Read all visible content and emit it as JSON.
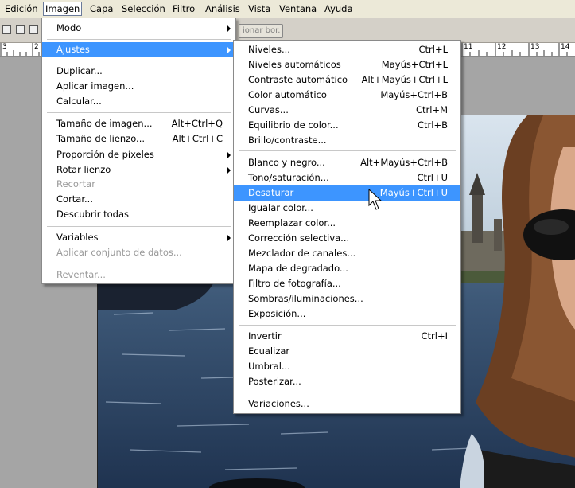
{
  "menubar": {
    "items": [
      {
        "label": "Edición"
      },
      {
        "label": "Imagen"
      },
      {
        "label": "Capa"
      },
      {
        "label": "Selección"
      },
      {
        "label": "Filtro"
      },
      {
        "label": "Análisis"
      },
      {
        "label": "Vista"
      },
      {
        "label": "Ventana"
      },
      {
        "label": "Ayuda"
      }
    ]
  },
  "options": {
    "button_label": "ionar bor."
  },
  "ruler": {
    "left_labels": [
      "3",
      "2"
    ],
    "right_labels": [
      "11",
      "12",
      "13",
      "14"
    ]
  },
  "imagen_menu": {
    "items": [
      {
        "label": "Modo",
        "shortcut": "",
        "submenu": true
      },
      {
        "label": "Ajustes",
        "shortcut": "",
        "submenu": true,
        "selected": true
      },
      {
        "label": "Duplicar...",
        "shortcut": ""
      },
      {
        "label": "Aplicar imagen...",
        "shortcut": ""
      },
      {
        "label": "Calcular...",
        "shortcut": ""
      },
      {
        "label": "Tamaño de imagen...",
        "shortcut": "Alt+Ctrl+Q"
      },
      {
        "label": "Tamaño de lienzo...",
        "shortcut": "Alt+Ctrl+C"
      },
      {
        "label": "Proporción de píxeles",
        "shortcut": "",
        "submenu": true
      },
      {
        "label": "Rotar lienzo",
        "shortcut": "",
        "submenu": true
      },
      {
        "label": "Recortar",
        "shortcut": "",
        "disabled": true
      },
      {
        "label": "Cortar...",
        "shortcut": ""
      },
      {
        "label": "Descubrir todas",
        "shortcut": ""
      },
      {
        "label": "Variables",
        "shortcut": "",
        "submenu": true
      },
      {
        "label": "Aplicar conjunto de datos...",
        "shortcut": "",
        "disabled": true
      },
      {
        "label": "Reventar...",
        "shortcut": "",
        "disabled": true
      }
    ]
  },
  "ajustes_menu": {
    "items": [
      {
        "label": "Niveles...",
        "shortcut": "Ctrl+L"
      },
      {
        "label": "Niveles automáticos",
        "shortcut": "Mayús+Ctrl+L"
      },
      {
        "label": "Contraste automático",
        "shortcut": "Alt+Mayús+Ctrl+L"
      },
      {
        "label": "Color automático",
        "shortcut": "Mayús+Ctrl+B"
      },
      {
        "label": "Curvas...",
        "shortcut": "Ctrl+M"
      },
      {
        "label": "Equilibrio de color...",
        "shortcut": "Ctrl+B"
      },
      {
        "label": "Brillo/contraste...",
        "shortcut": ""
      },
      {
        "label": "Blanco y negro...",
        "shortcut": "Alt+Mayús+Ctrl+B"
      },
      {
        "label": "Tono/saturación...",
        "shortcut": "Ctrl+U"
      },
      {
        "label": "Desaturar",
        "shortcut": "Mayús+Ctrl+U",
        "selected": true
      },
      {
        "label": "Igualar color...",
        "shortcut": ""
      },
      {
        "label": "Reemplazar color...",
        "shortcut": ""
      },
      {
        "label": "Corrección selectiva...",
        "shortcut": ""
      },
      {
        "label": "Mezclador de canales...",
        "shortcut": ""
      },
      {
        "label": "Mapa de degradado...",
        "shortcut": ""
      },
      {
        "label": "Filtro de fotografía...",
        "shortcut": ""
      },
      {
        "label": "Sombras/iluminaciones...",
        "shortcut": ""
      },
      {
        "label": "Exposición...",
        "shortcut": ""
      },
      {
        "label": "Invertir",
        "shortcut": "Ctrl+I"
      },
      {
        "label": "Ecualizar",
        "shortcut": ""
      },
      {
        "label": "Umbral...",
        "shortcut": ""
      },
      {
        "label": "Posterizar...",
        "shortcut": ""
      },
      {
        "label": "Variaciones...",
        "shortcut": ""
      }
    ]
  },
  "colors": {
    "selection": "#3d95ff",
    "menubar": "#ece9d8",
    "workspace": "#a5a5a5"
  }
}
